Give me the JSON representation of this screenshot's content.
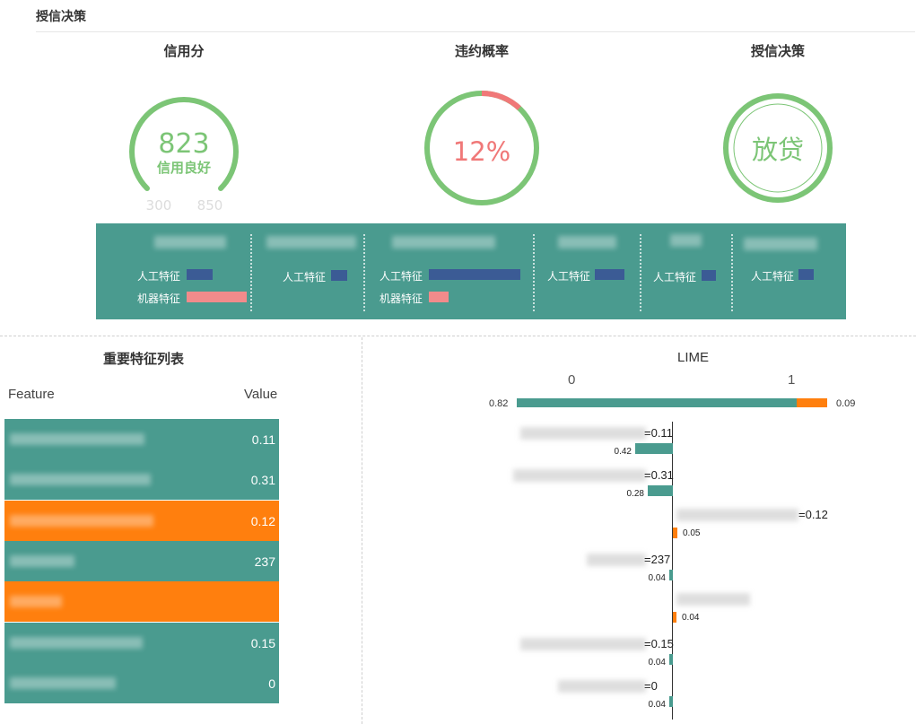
{
  "section": {
    "title": "授信决策"
  },
  "kpis": {
    "credit": {
      "title": "信用分",
      "score": "823",
      "status": "信用良好",
      "min": "300",
      "max": "850"
    },
    "default": {
      "title": "违约概率",
      "value": "12%",
      "fraction": 0.12
    },
    "decision": {
      "title": "授信决策",
      "value": "放贷"
    }
  },
  "features_band": {
    "human_label": "人工特征",
    "machine_label": "机器特征",
    "columns": [
      {
        "human": 0.28,
        "machine": 0.66
      },
      {
        "human": 0.18
      },
      {
        "human": 1.0,
        "machine": 0.22
      },
      {
        "human": 0.32
      },
      {
        "human": 0.16
      },
      {
        "human": 0.17
      }
    ]
  },
  "table": {
    "title": "重要特征列表",
    "col_feature": "Feature",
    "col_value": "Value",
    "rows": [
      {
        "value": "0.11",
        "color": "teal"
      },
      {
        "value": "0.31",
        "color": "teal"
      },
      {
        "value": "0.12",
        "color": "orange"
      },
      {
        "value": "237",
        "color": "teal"
      },
      {
        "value": "",
        "color": "orange"
      },
      {
        "value": "0.15",
        "color": "teal"
      },
      {
        "value": "0",
        "color": "teal"
      }
    ]
  },
  "lime": {
    "title": "LIME",
    "class_0": "0",
    "class_1": "1",
    "prob_0": "0.82",
    "prob_1": "0.09",
    "prob_0_value": 0.82,
    "prob_1_value": 0.09,
    "items": [
      {
        "label": "=0.11",
        "weight": "0.42",
        "direction": "0",
        "magnitude": 0.42
      },
      {
        "label": "=0.31",
        "weight": "0.28",
        "direction": "0",
        "magnitude": 0.28
      },
      {
        "label": "=0.12",
        "weight": "0.05",
        "direction": "1",
        "magnitude": 0.05
      },
      {
        "label": "=237",
        "weight": "0.04",
        "direction": "0",
        "magnitude": 0.04
      },
      {
        "label": "",
        "weight": "0.04",
        "direction": "1",
        "magnitude": 0.04
      },
      {
        "label": "=0.15",
        "weight": "0.04",
        "direction": "0",
        "magnitude": 0.04
      },
      {
        "label": "=0",
        "weight": "0.04",
        "direction": "0",
        "magnitude": 0.04
      }
    ]
  },
  "colors": {
    "teal": "#4a9b8f",
    "orange": "#ff7f0e",
    "green": "#7cc576",
    "red": "#f07878",
    "navy": "#3b5b95",
    "pink": "#f28b8b"
  }
}
